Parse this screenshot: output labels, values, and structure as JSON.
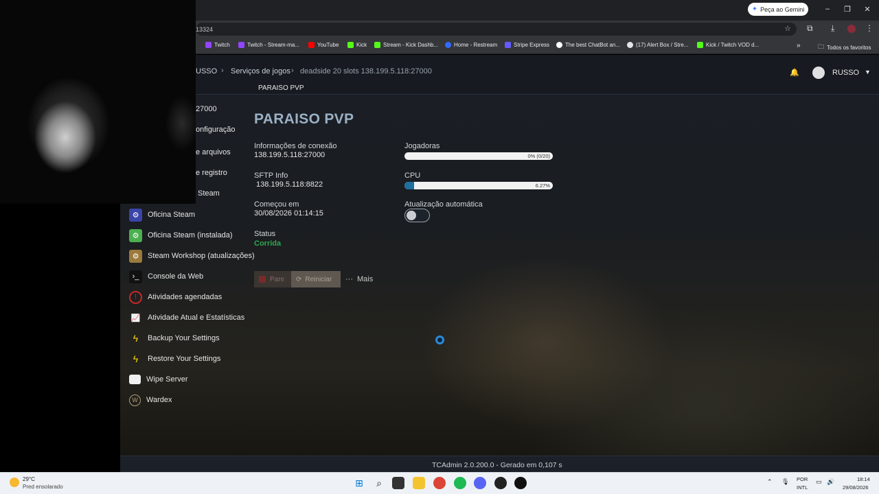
{
  "browser": {
    "gemini_button": "Peça ao Gemini",
    "url_fragment": "13324",
    "bookmarks": [
      {
        "label": "Twitch",
        "color": "#9146ff"
      },
      {
        "label": "Twitch - Stream-ma...",
        "color": "#9146ff"
      },
      {
        "label": "YouTube",
        "color": "#ff0000"
      },
      {
        "label": "Kick",
        "color": "#53fc18"
      },
      {
        "label": "Stream - Kick Dashb...",
        "color": "#53fc18"
      },
      {
        "label": "Home - Restream",
        "color": "#2f6bff"
      },
      {
        "label": "Stripe Express",
        "color": "#635bff"
      },
      {
        "label": "The best ChatBot an...",
        "color": "#ffffff"
      },
      {
        "label": "(17) Alert Box / Stre...",
        "color": "#e5e5e5"
      },
      {
        "label": "Kick / Twitch VOD d...",
        "color": "#53fc18"
      }
    ],
    "all_bookmarks": "Todos os favoritos",
    "more_bookmarks": "»"
  },
  "breadcrumb": {
    "user": "USSO",
    "services": "Serviços de jogos",
    "server": "deadside 20 slots 138.199.5.118:27000",
    "separator": "›"
  },
  "subtitle": "PARAISO PVP",
  "user_menu": {
    "name": "RUSSO"
  },
  "sidebar": {
    "partial_items": [
      "27000",
      "onfiguração",
      "e arquivos",
      "e registro",
      "Steam"
    ],
    "items": [
      {
        "label": "Oficina Steam",
        "icon": "steam-workshop-icon",
        "color": "#3b44a8"
      },
      {
        "label": "Oficina Steam (instalada)",
        "icon": "steam-installed-icon",
        "color": "#4caf50"
      },
      {
        "label": "Steam Workshop (atualizações)",
        "icon": "steam-updates-icon",
        "color": "#9c7a3c"
      },
      {
        "label": "Console da Web",
        "icon": "terminal-icon",
        "color": "#111111"
      },
      {
        "label": "Atividades agendadas",
        "icon": "clock-icon",
        "color": "#c62828"
      },
      {
        "label": "Atividade Atual e Estatísticas",
        "icon": "chart-icon",
        "color": "#1d2630"
      },
      {
        "label": "Backup Your Settings",
        "icon": "lightning-icon",
        "color": "#1d2630"
      },
      {
        "label": "Restore Your Settings",
        "icon": "lightning-icon",
        "color": "#1d2630"
      },
      {
        "label": "Wipe Server",
        "icon": "eraser-icon",
        "color": "#1d2630"
      },
      {
        "label": "Wardex",
        "icon": "wardex-icon",
        "color": "#1d2630"
      }
    ]
  },
  "server": {
    "title": "PARAISO PVP",
    "connection_label": "Informações de conexão",
    "connection_value": "138.199.5.118:27000",
    "sftp_label": "SFTP Info",
    "sftp_value": " 138.199.5.118:8822",
    "started_label": "Começou em",
    "started_value": "30/08/2026 01:14:15",
    "status_label": "Status",
    "status_value": "Corrida",
    "players_label": "Jogadoras",
    "players_text": "0% (0/20)",
    "players_fraction": 0.0,
    "cpu_label": "CPU",
    "cpu_text": "6.27%",
    "cpu_fraction": 0.0627,
    "autoupdate_label": "Atualização automática",
    "autoupdate_on": false
  },
  "actions": {
    "stop": "Pare",
    "restart": "Reiniciar",
    "more": "Mais"
  },
  "footer": "TCAdmin 2.0.200.0 - Gerado em 0,107 s",
  "taskbar": {
    "weather_temp": "29°C",
    "weather_desc": "Pred ensolarado",
    "lang_1": "POR",
    "lang_2": "INTL",
    "time": "18:14",
    "date": "29/08/2026"
  }
}
